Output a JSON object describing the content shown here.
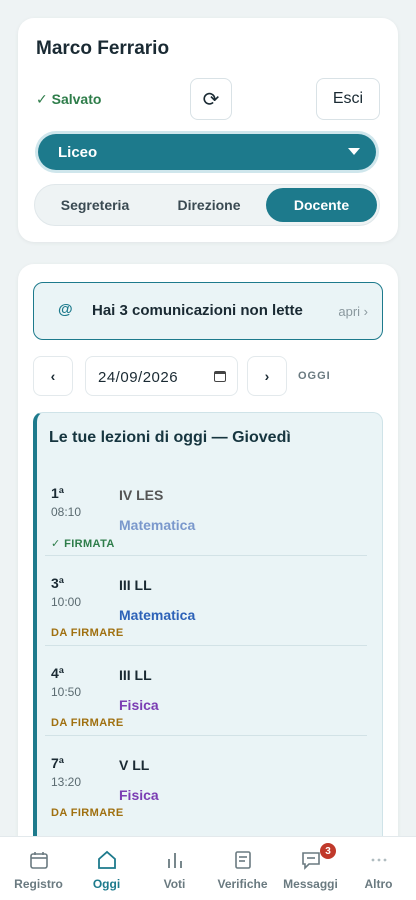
{
  "header": {
    "user_name": "Marco Ferrario",
    "saved_status": "✓ Salvato",
    "refresh_icon": "⟳",
    "logout_label": "Esci",
    "school_selected": "Liceo",
    "roles": [
      "Segreteria",
      "Direzione",
      "Docente"
    ],
    "active_role": "Docente"
  },
  "main": {
    "notice_icon": "@",
    "notice_text": "Hai 3 comunicazioni non lette",
    "notice_action": "apri ›",
    "prev_label": "‹",
    "next_label": "›",
    "date_value": "24/09/2026",
    "today_label": "OGGI",
    "lessons_title": "Le tue lezioni di oggi — Giovedì",
    "lessons": [
      {
        "slot": "1ª",
        "time": "08:10",
        "class": "IV LES",
        "subject": "Matematica",
        "status": "✓ FIRMATA"
      },
      {
        "slot": "3ª",
        "time": "10:00",
        "class": "III LL",
        "subject": "Matematica",
        "status": "DA FIRMARE"
      },
      {
        "slot": "4ª",
        "time": "10:50",
        "class": "III LL",
        "subject": "Fisica",
        "status": "DA FIRMARE"
      },
      {
        "slot": "7ª",
        "time": "13:20",
        "class": "V LL",
        "subject": "Fisica",
        "status": "DA FIRMARE"
      }
    ]
  },
  "tabbar": {
    "tabs": [
      "Registro",
      "Oggi",
      "Voti",
      "Verifiche",
      "Messaggi",
      "Altro"
    ],
    "active": "Oggi",
    "messages_badge": "3"
  },
  "colors": {
    "accent": "#1d7a8c",
    "signed": "#2e7d4a",
    "to_sign": "#a07010",
    "math": "#2d62b8",
    "physics": "#7b3db3"
  }
}
